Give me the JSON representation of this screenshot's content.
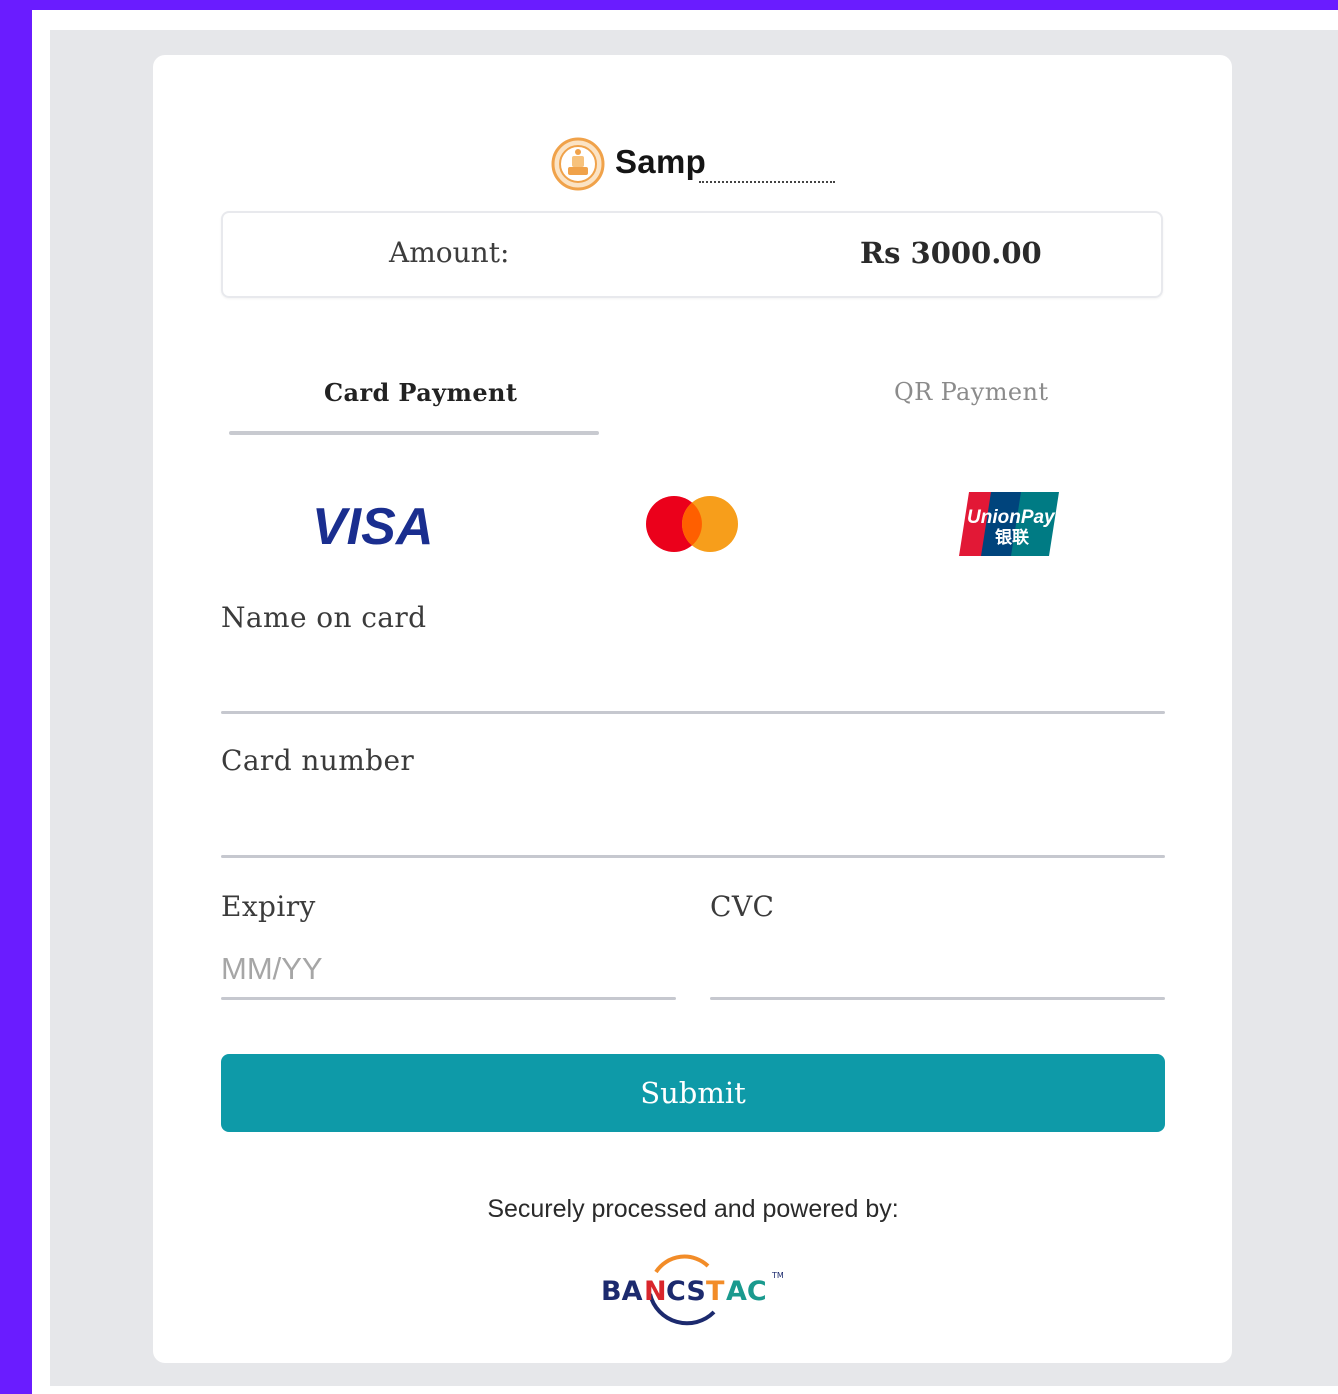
{
  "brand": {
    "name": "Samp"
  },
  "amount": {
    "label": "Amount:",
    "value": "Rs 3000.00"
  },
  "tabs": [
    {
      "label": "Card Payment",
      "active": true
    },
    {
      "label": "QR Payment",
      "active": false
    }
  ],
  "card_brands": {
    "visa": "VISA",
    "mastercard": "mastercard-icon",
    "unionpay_line1": "UnionPay",
    "unionpay_line2": "银联"
  },
  "form": {
    "name": {
      "label": "Name on card",
      "value": "",
      "placeholder": ""
    },
    "number": {
      "label": "Card number",
      "value": "",
      "placeholder": ""
    },
    "expiry": {
      "label": "Expiry",
      "value": "",
      "placeholder": "MM/YY"
    },
    "cvc": {
      "label": "CVC",
      "value": "",
      "placeholder": ""
    }
  },
  "submit_label": "Submit",
  "footer": {
    "secure_text": "Securely processed and powered by:",
    "bancstac_left": "BA",
    "bancstac_n": "N",
    "bancstac_mid": "CS",
    "bancstac_t": "T",
    "bancstac_right": "AC",
    "bancstac_tm": "TM"
  },
  "colors": {
    "page_border": "#6a1cff",
    "panel_bg": "#e6e7ea",
    "submit_bg": "#0e9aa8",
    "visa_blue": "#1a2e8f",
    "mc_red": "#eb001b",
    "mc_orange": "#f79e1b"
  }
}
